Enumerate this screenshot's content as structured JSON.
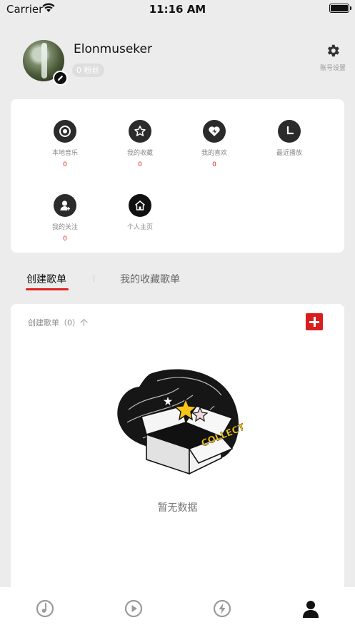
{
  "status_bar": {
    "carrier": "Carrier",
    "time": "11:16 AM"
  },
  "profile": {
    "username": "Elonmuseker",
    "fans": "0 粉丝",
    "settings_label": "账号设置"
  },
  "grid": [
    {
      "label": "本地音乐",
      "count": "0",
      "icon": "disc-icon"
    },
    {
      "label": "我的收藏",
      "count": "0",
      "icon": "star-icon"
    },
    {
      "label": "我的喜欢",
      "count": "0",
      "icon": "heart-icon"
    },
    {
      "label": "最近播放",
      "count": "",
      "icon": "clock-icon"
    },
    {
      "label": "我的关注",
      "count": "0",
      "icon": "user-add-icon"
    },
    {
      "label": "个人主页",
      "count": "",
      "icon": "home-icon"
    }
  ],
  "tabs": {
    "created": "创建歌单",
    "collected": "我的收藏歌单"
  },
  "playlist": {
    "count_label": "创建歌单（0）个",
    "empty_text": "暂无数据",
    "collect_word": "COLLECT"
  },
  "tab_bar": {
    "items": [
      "music-note-icon",
      "play-icon",
      "lightning-icon",
      "user-icon"
    ],
    "active_color": "#111111",
    "inactive_color": "#9a9a9a"
  },
  "colors": {
    "accent": "#e02020",
    "background": "#ececec"
  }
}
